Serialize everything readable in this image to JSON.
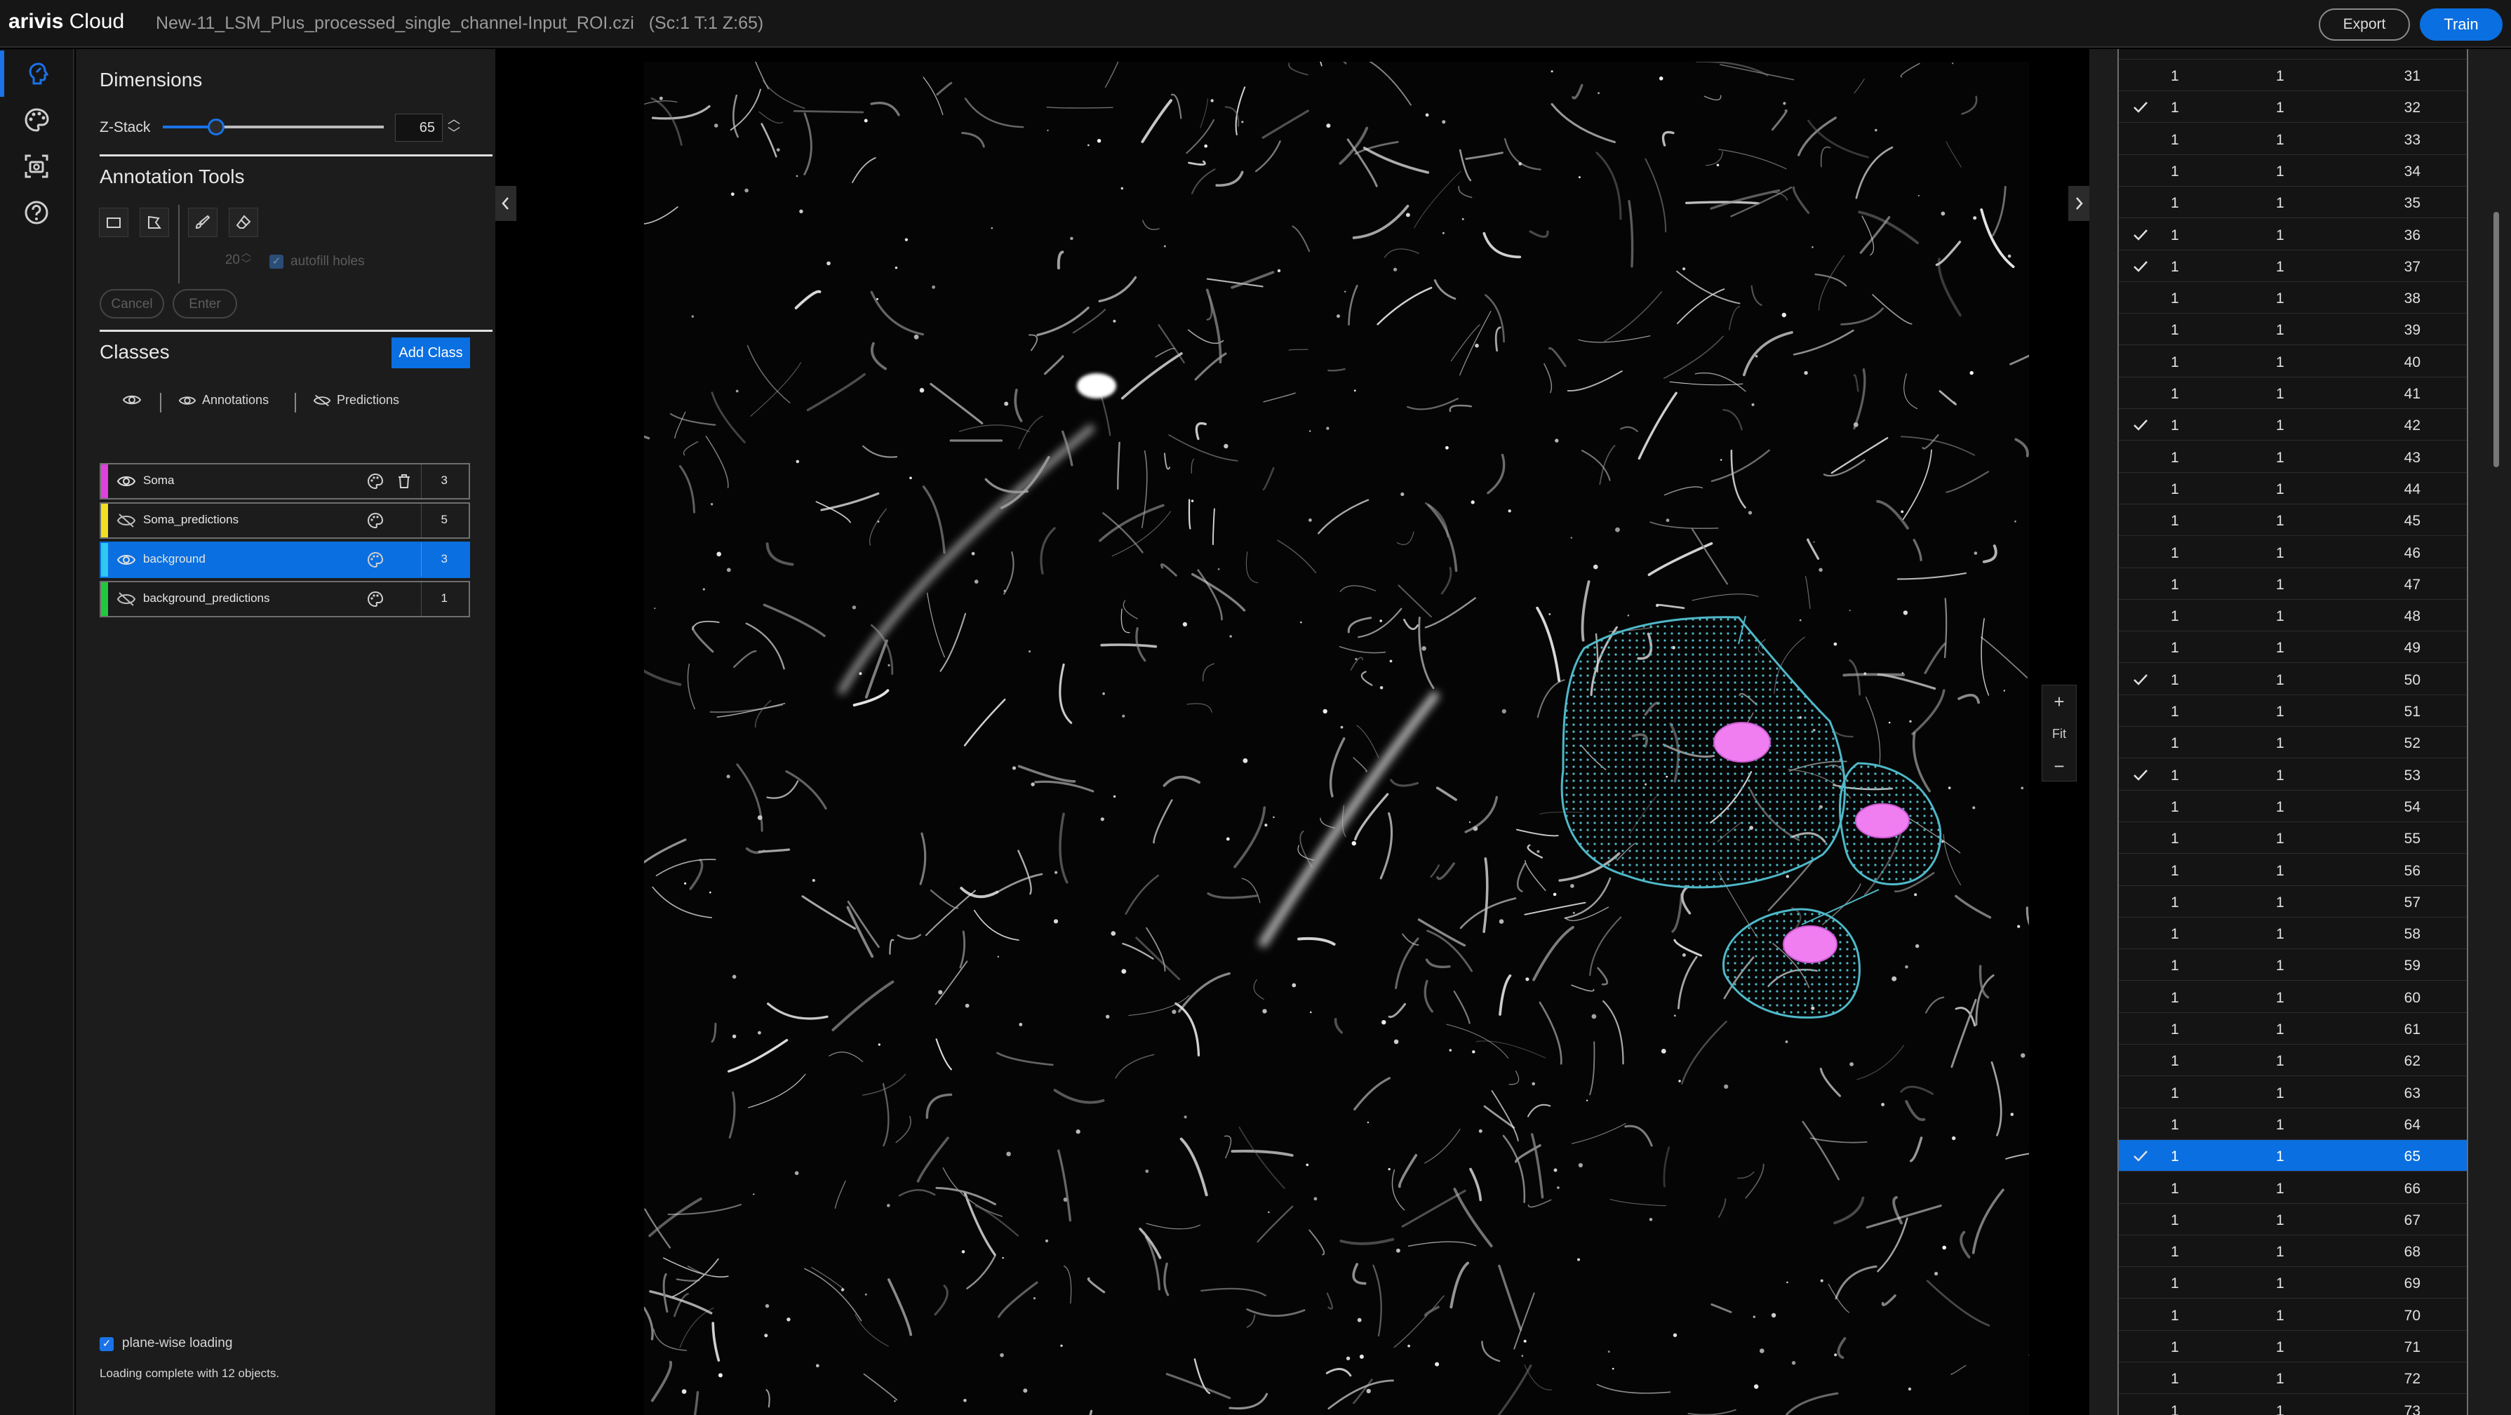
{
  "app": {
    "brand_bold": "arivis",
    "brand_rest": " Cloud",
    "filename": "New-11_LSM_Plus_processed_single_channel-Input_ROI.czi",
    "position": "(Sc:1 T:1 Z:65)"
  },
  "toolbar": {
    "export_label": "Export",
    "train_label": "Train"
  },
  "rail": {
    "items": [
      {
        "icon": "annotate-icon",
        "active": true
      },
      {
        "icon": "palette-icon",
        "active": false
      },
      {
        "icon": "snapshot-icon",
        "active": false
      },
      {
        "icon": "help-icon",
        "active": false
      }
    ]
  },
  "dimensions": {
    "title": "Dimensions",
    "zstack_label": "Z-Stack",
    "zstack_value": "65",
    "zstack_fraction": 0.25
  },
  "annotation_tools": {
    "title": "Annotation Tools",
    "tools": [
      "rectangle-icon",
      "polygon-icon",
      "brush-icon",
      "eraser-icon"
    ],
    "brush_size": "20",
    "autofill_label": "autofill holes",
    "cancel_label": "Cancel",
    "enter_label": "Enter"
  },
  "classes": {
    "title": "Classes",
    "add_label": "Add Class",
    "annotations_label": "Annotations",
    "predictions_label": "Predictions",
    "items": [
      {
        "name": "Soma",
        "count": "3",
        "color": "#e040e0",
        "visible": true,
        "selected": false
      },
      {
        "name": "Soma_predictions",
        "count": "5",
        "color": "#f0e020",
        "visible": false,
        "selected": false
      },
      {
        "name": "background",
        "count": "3",
        "color": "#2ec8f0",
        "visible": true,
        "selected": true
      },
      {
        "name": "background_predictions",
        "count": "1",
        "color": "#22c840",
        "visible": false,
        "selected": false
      }
    ]
  },
  "footer": {
    "planewise_label": "plane-wise loading",
    "status": "Loading complete with 12 objects."
  },
  "viewer": {
    "zoom_in": "+",
    "zoom_fit": "Fit",
    "zoom_out": "−",
    "annotation_color": "#4fb8c8",
    "soma_color": "#f07ef0"
  },
  "ztable": {
    "rows": [
      {
        "c1": "1",
        "c2": "1",
        "z": "31",
        "checked": false
      },
      {
        "c1": "1",
        "c2": "1",
        "z": "32",
        "checked": true
      },
      {
        "c1": "1",
        "c2": "1",
        "z": "33",
        "checked": false
      },
      {
        "c1": "1",
        "c2": "1",
        "z": "34",
        "checked": false
      },
      {
        "c1": "1",
        "c2": "1",
        "z": "35",
        "checked": false
      },
      {
        "c1": "1",
        "c2": "1",
        "z": "36",
        "checked": true
      },
      {
        "c1": "1",
        "c2": "1",
        "z": "37",
        "checked": true
      },
      {
        "c1": "1",
        "c2": "1",
        "z": "38",
        "checked": false
      },
      {
        "c1": "1",
        "c2": "1",
        "z": "39",
        "checked": false
      },
      {
        "c1": "1",
        "c2": "1",
        "z": "40",
        "checked": false
      },
      {
        "c1": "1",
        "c2": "1",
        "z": "41",
        "checked": false
      },
      {
        "c1": "1",
        "c2": "1",
        "z": "42",
        "checked": true
      },
      {
        "c1": "1",
        "c2": "1",
        "z": "43",
        "checked": false
      },
      {
        "c1": "1",
        "c2": "1",
        "z": "44",
        "checked": false
      },
      {
        "c1": "1",
        "c2": "1",
        "z": "45",
        "checked": false
      },
      {
        "c1": "1",
        "c2": "1",
        "z": "46",
        "checked": false
      },
      {
        "c1": "1",
        "c2": "1",
        "z": "47",
        "checked": false
      },
      {
        "c1": "1",
        "c2": "1",
        "z": "48",
        "checked": false
      },
      {
        "c1": "1",
        "c2": "1",
        "z": "49",
        "checked": false
      },
      {
        "c1": "1",
        "c2": "1",
        "z": "50",
        "checked": true
      },
      {
        "c1": "1",
        "c2": "1",
        "z": "51",
        "checked": false
      },
      {
        "c1": "1",
        "c2": "1",
        "z": "52",
        "checked": false
      },
      {
        "c1": "1",
        "c2": "1",
        "z": "53",
        "checked": true
      },
      {
        "c1": "1",
        "c2": "1",
        "z": "54",
        "checked": false
      },
      {
        "c1": "1",
        "c2": "1",
        "z": "55",
        "checked": false
      },
      {
        "c1": "1",
        "c2": "1",
        "z": "56",
        "checked": false
      },
      {
        "c1": "1",
        "c2": "1",
        "z": "57",
        "checked": false
      },
      {
        "c1": "1",
        "c2": "1",
        "z": "58",
        "checked": false
      },
      {
        "c1": "1",
        "c2": "1",
        "z": "59",
        "checked": false
      },
      {
        "c1": "1",
        "c2": "1",
        "z": "60",
        "checked": false
      },
      {
        "c1": "1",
        "c2": "1",
        "z": "61",
        "checked": false
      },
      {
        "c1": "1",
        "c2": "1",
        "z": "62",
        "checked": false
      },
      {
        "c1": "1",
        "c2": "1",
        "z": "63",
        "checked": false
      },
      {
        "c1": "1",
        "c2": "1",
        "z": "64",
        "checked": false
      },
      {
        "c1": "1",
        "c2": "1",
        "z": "65",
        "checked": true,
        "selected": true
      },
      {
        "c1": "1",
        "c2": "1",
        "z": "66",
        "checked": false
      },
      {
        "c1": "1",
        "c2": "1",
        "z": "67",
        "checked": false
      },
      {
        "c1": "1",
        "c2": "1",
        "z": "68",
        "checked": false
      },
      {
        "c1": "1",
        "c2": "1",
        "z": "69",
        "checked": false
      },
      {
        "c1": "1",
        "c2": "1",
        "z": "70",
        "checked": false
      },
      {
        "c1": "1",
        "c2": "1",
        "z": "71",
        "checked": false
      },
      {
        "c1": "1",
        "c2": "1",
        "z": "72",
        "checked": false
      },
      {
        "c1": "1",
        "c2": "1",
        "z": "73",
        "checked": false
      }
    ]
  }
}
